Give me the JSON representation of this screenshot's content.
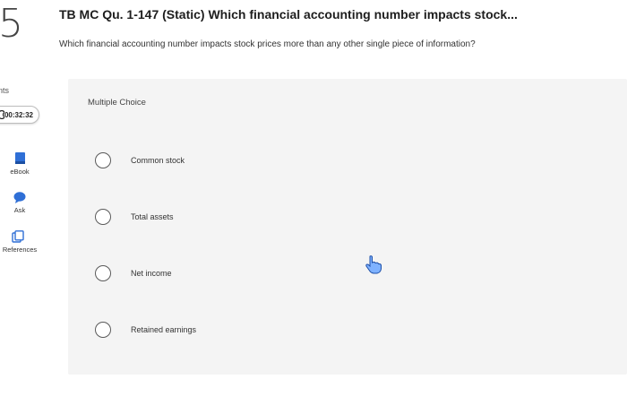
{
  "question_number": "5",
  "sidebar": {
    "points_label": "nts",
    "timer": "00:32:32",
    "tools": [
      {
        "label": "eBook",
        "icon": "book-icon"
      },
      {
        "label": "Ask",
        "icon": "chat-bubble-icon"
      },
      {
        "label": "References",
        "icon": "references-icon"
      }
    ]
  },
  "question": {
    "title": "TB MC Qu. 1-147 (Static) Which financial accounting number impacts stock...",
    "text": "Which financial accounting number impacts stock prices more than any other single piece of information?",
    "type_label": "Multiple Choice",
    "options": [
      "Common stock",
      "Total assets",
      "Net income",
      "Retained earnings"
    ]
  },
  "colors": {
    "accent_blue": "#2f6fd6",
    "panel_bg": "#f4f4f4",
    "radio_border": "#5a5a5a"
  }
}
